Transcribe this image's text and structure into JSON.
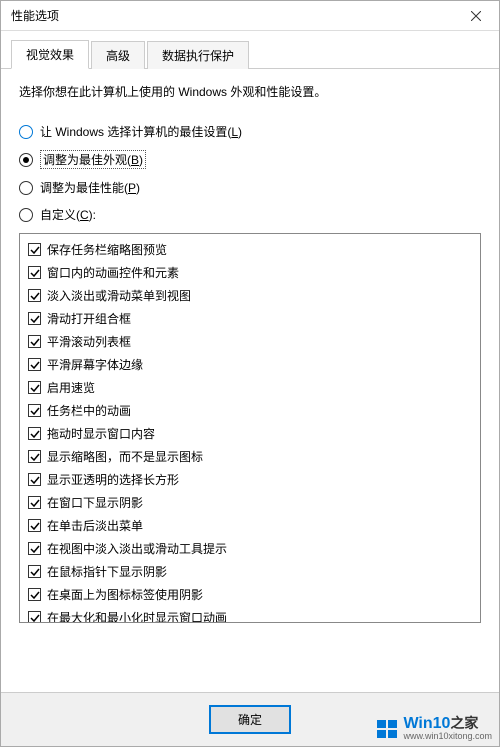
{
  "window": {
    "title": "性能选项"
  },
  "tabs": [
    {
      "label": "视觉效果",
      "active": true
    },
    {
      "label": "高级",
      "active": false
    },
    {
      "label": "数据执行保护",
      "active": false
    }
  ],
  "description": "选择你想在此计算机上使用的 Windows 外观和性能设置。",
  "radios": [
    {
      "key": "auto",
      "label_pre": "让 Windows 选择计算机的最佳设置(",
      "hot": "L",
      "label_post": ")",
      "checked": false
    },
    {
      "key": "best-look",
      "label_pre": "调整为最佳外观(",
      "hot": "B",
      "label_post": ")",
      "checked": true
    },
    {
      "key": "best-perf",
      "label_pre": "调整为最佳性能(",
      "hot": "P",
      "label_post": ")",
      "checked": false
    },
    {
      "key": "custom",
      "label_pre": "自定义(",
      "hot": "C",
      "label_post": "):",
      "checked": false
    }
  ],
  "checks": [
    {
      "label": "保存任务栏缩略图预览",
      "checked": true
    },
    {
      "label": "窗口内的动画控件和元素",
      "checked": true
    },
    {
      "label": "淡入淡出或滑动菜单到视图",
      "checked": true
    },
    {
      "label": "滑动打开组合框",
      "checked": true
    },
    {
      "label": "平滑滚动列表框",
      "checked": true
    },
    {
      "label": "平滑屏幕字体边缘",
      "checked": true
    },
    {
      "label": "启用速览",
      "checked": true
    },
    {
      "label": "任务栏中的动画",
      "checked": true
    },
    {
      "label": "拖动时显示窗口内容",
      "checked": true
    },
    {
      "label": "显示缩略图，而不是显示图标",
      "checked": true
    },
    {
      "label": "显示亚透明的选择长方形",
      "checked": true
    },
    {
      "label": "在窗口下显示阴影",
      "checked": true
    },
    {
      "label": "在单击后淡出菜单",
      "checked": true
    },
    {
      "label": "在视图中淡入淡出或滑动工具提示",
      "checked": true
    },
    {
      "label": "在鼠标指针下显示阴影",
      "checked": true
    },
    {
      "label": "在桌面上为图标标签使用阴影",
      "checked": true
    },
    {
      "label": "在最大化和最小化时显示窗口动画",
      "checked": true
    }
  ],
  "buttons": {
    "ok": "确定"
  },
  "watermark": {
    "brand_main": "Win10",
    "brand_sub": "之家",
    "url": "www.win10xitong.com"
  }
}
